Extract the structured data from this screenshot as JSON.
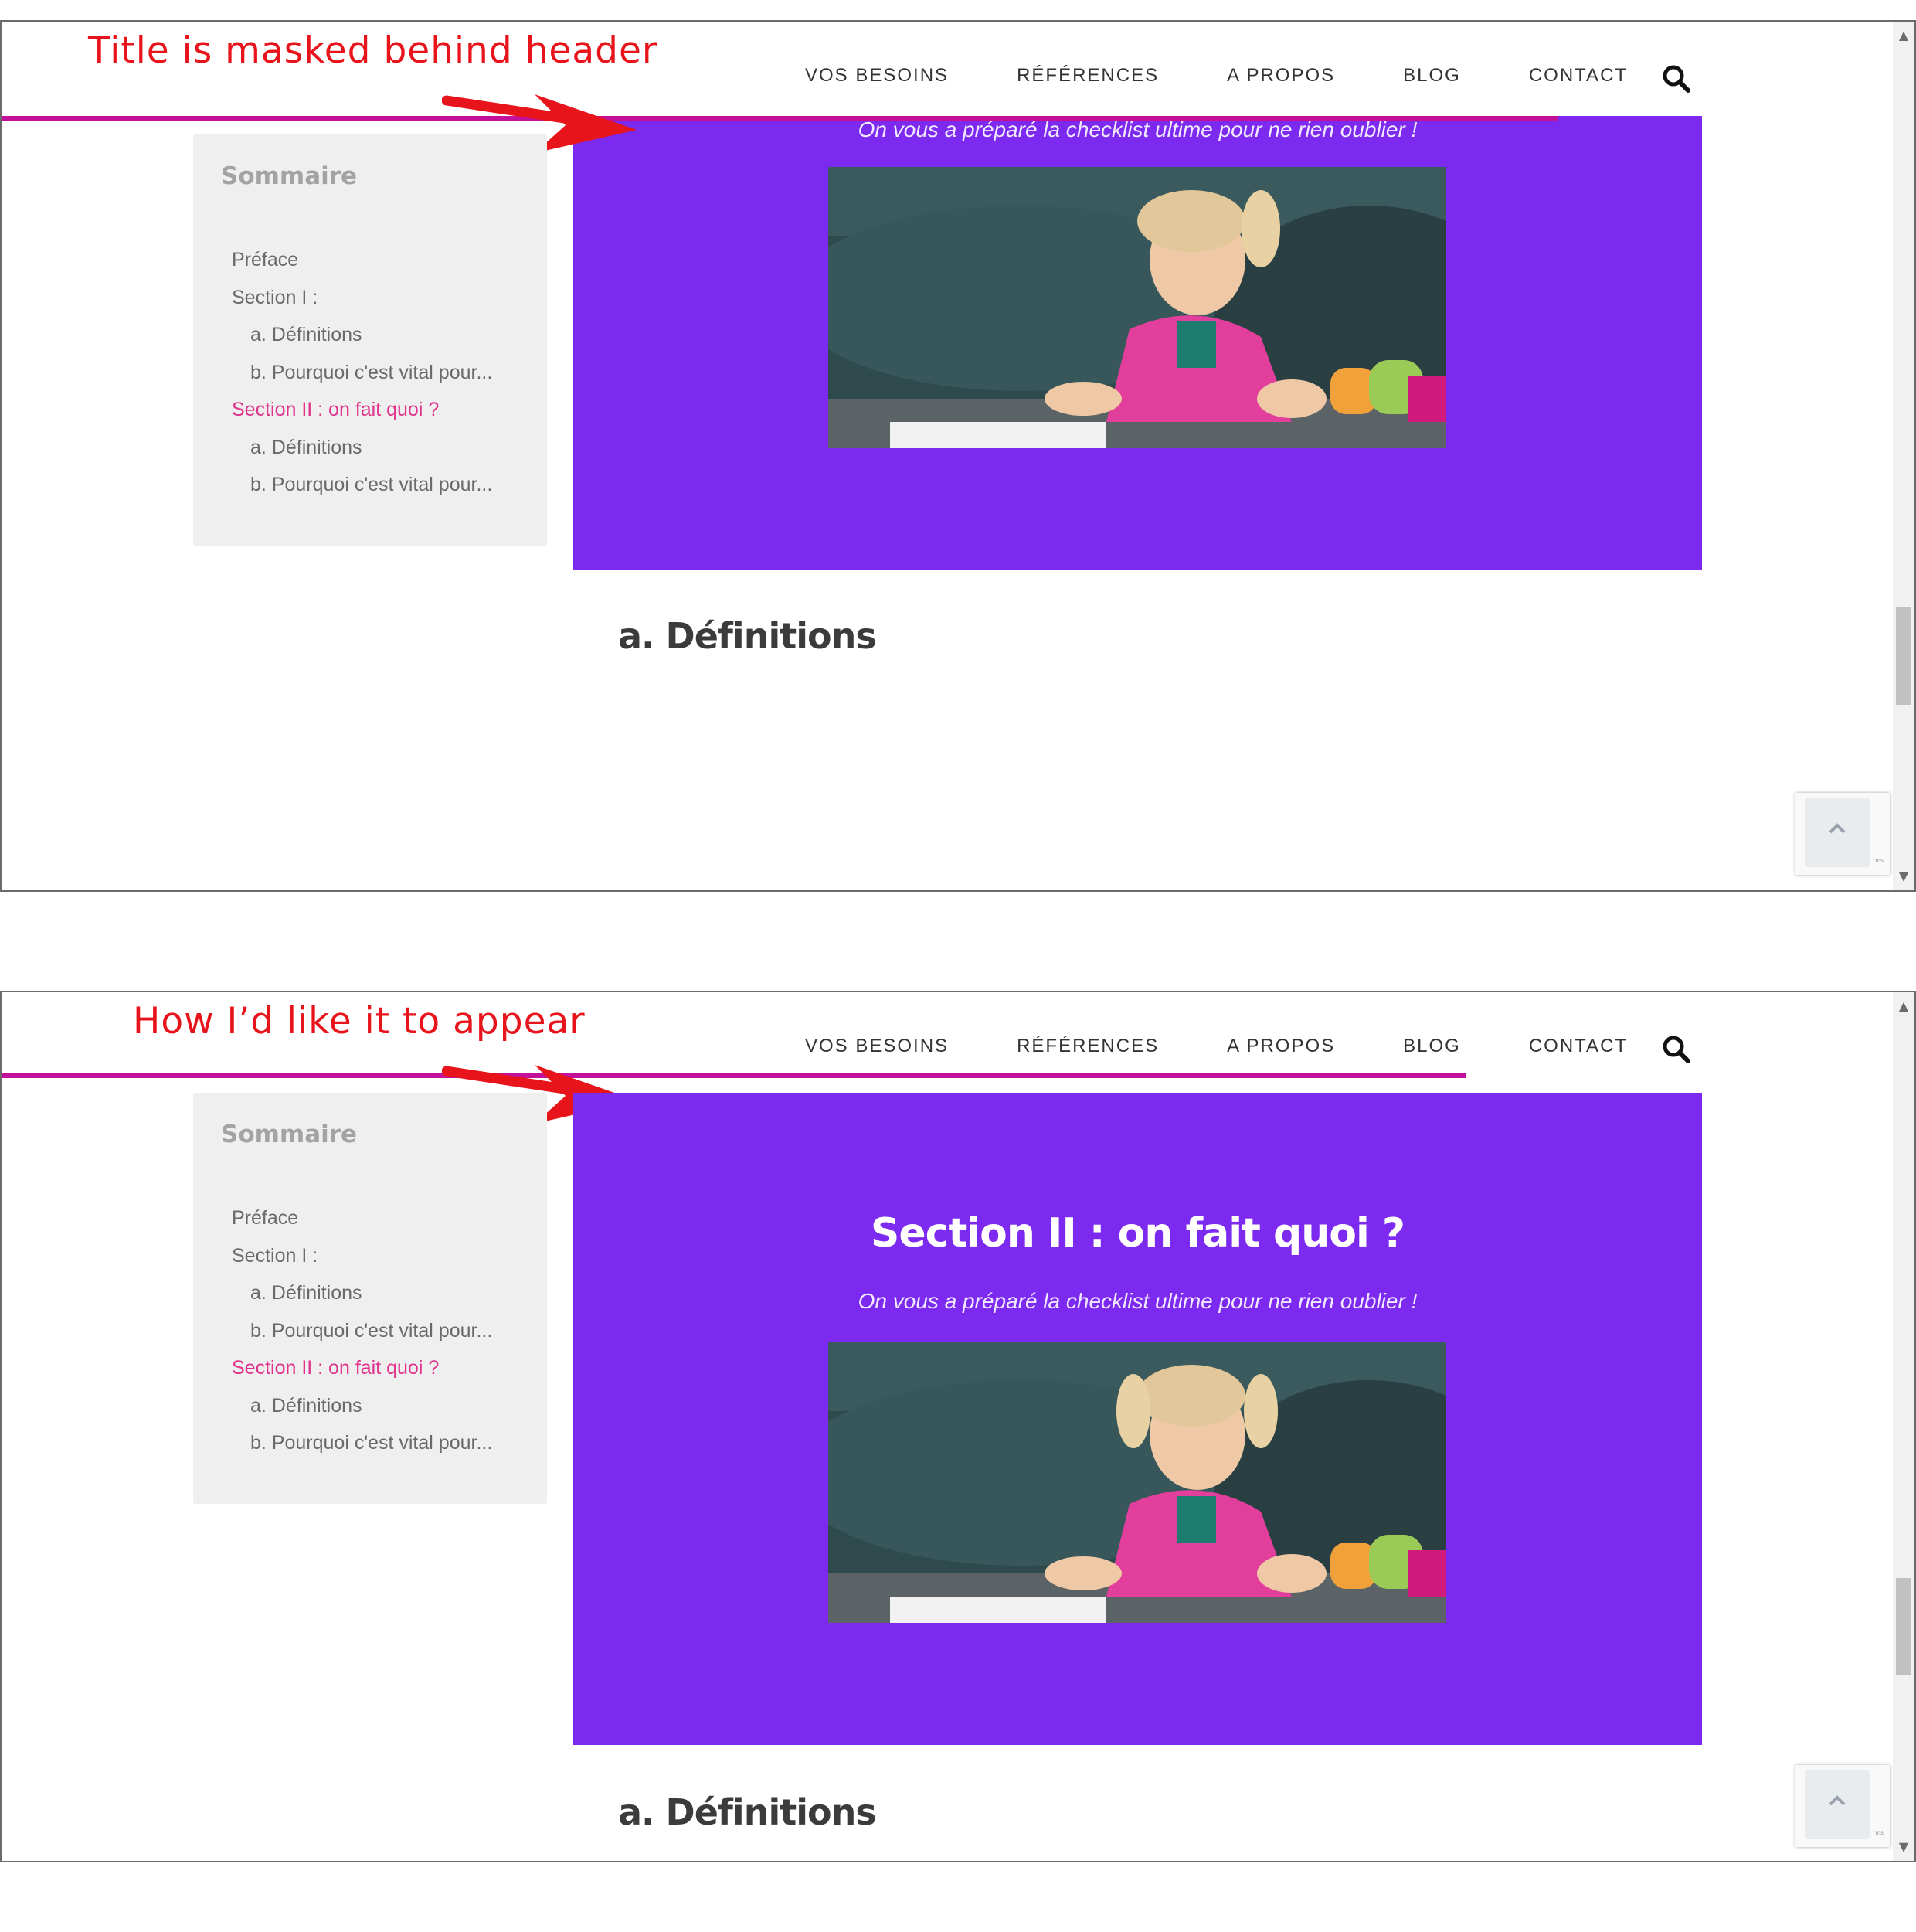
{
  "top_panel": {
    "annotation": "Title is masked behind header",
    "subtitle": "On vous a préparé la checklist ultime pour ne rien oublier !",
    "heading": "a. Définitions"
  },
  "bottom_panel": {
    "annotation": "How I’d like it to appear",
    "section_title": "Section II : on fait quoi ?",
    "subtitle": "On vous a préparé la checklist ultime pour ne rien oublier !",
    "heading": "a. Définitions"
  },
  "nav": {
    "items": [
      "VOS BESOINS",
      "RÉFÉRENCES",
      "A PROPOS",
      "BLOG",
      "CONTACT"
    ],
    "search_icon": "search-icon"
  },
  "sommaire": {
    "title": "Sommaire",
    "items": [
      {
        "label": "Préface",
        "level": 1,
        "active": false
      },
      {
        "label": "Section I :",
        "level": 1,
        "active": false
      },
      {
        "label": "a. Définitions",
        "level": 2,
        "active": false
      },
      {
        "label": "b. Pourquoi c'est vital pour...",
        "level": 2,
        "active": false
      },
      {
        "label": "Section II : on fait quoi ?",
        "level": 1,
        "active": true
      },
      {
        "label": "a. Définitions",
        "level": 2,
        "active": false
      },
      {
        "label": "b. Pourquoi c'est vital pour...",
        "level": 2,
        "active": false
      }
    ]
  },
  "colors": {
    "annotation_red": "#e8141b",
    "header_line": "#c2109a",
    "section_bg": "#7c2af0",
    "toc_active": "#e0318b",
    "sommaire_bg": "#efefef"
  },
  "icons": {
    "arrow": "arrow-right-icon",
    "back_to_top": "chevron-up-icon",
    "recaptcha": "recaptcha-badge"
  }
}
